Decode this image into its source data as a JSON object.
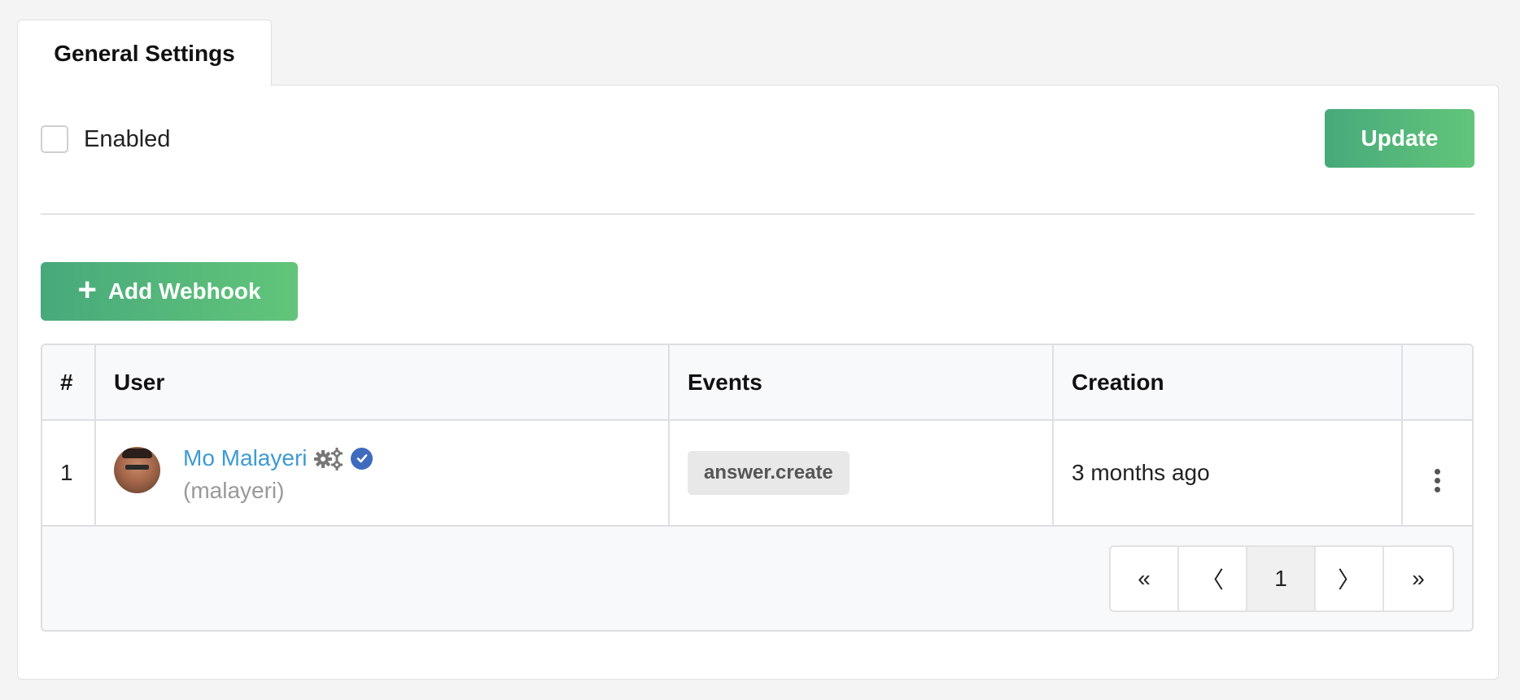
{
  "tabs": [
    {
      "label": "General Settings",
      "active": true
    }
  ],
  "settings": {
    "enabled_label": "Enabled",
    "enabled_checked": false,
    "update_label": "Update"
  },
  "webhooks": {
    "add_label": "Add Webhook",
    "columns": [
      "#",
      "User",
      "Events",
      "Creation",
      ""
    ],
    "rows": [
      {
        "num": "1",
        "user_name": "Mo Malayeri",
        "username": "(malayeri)",
        "event": "answer.create",
        "creation": "3 months ago"
      }
    ]
  },
  "pagination": {
    "first": "«",
    "prev": "〈",
    "current": "1",
    "next": "〉",
    "last": "»"
  },
  "colors": {
    "accent_start": "#47a97b",
    "accent_end": "#62c57a",
    "link": "#3d9ad6",
    "verified": "#3f6bbf"
  }
}
